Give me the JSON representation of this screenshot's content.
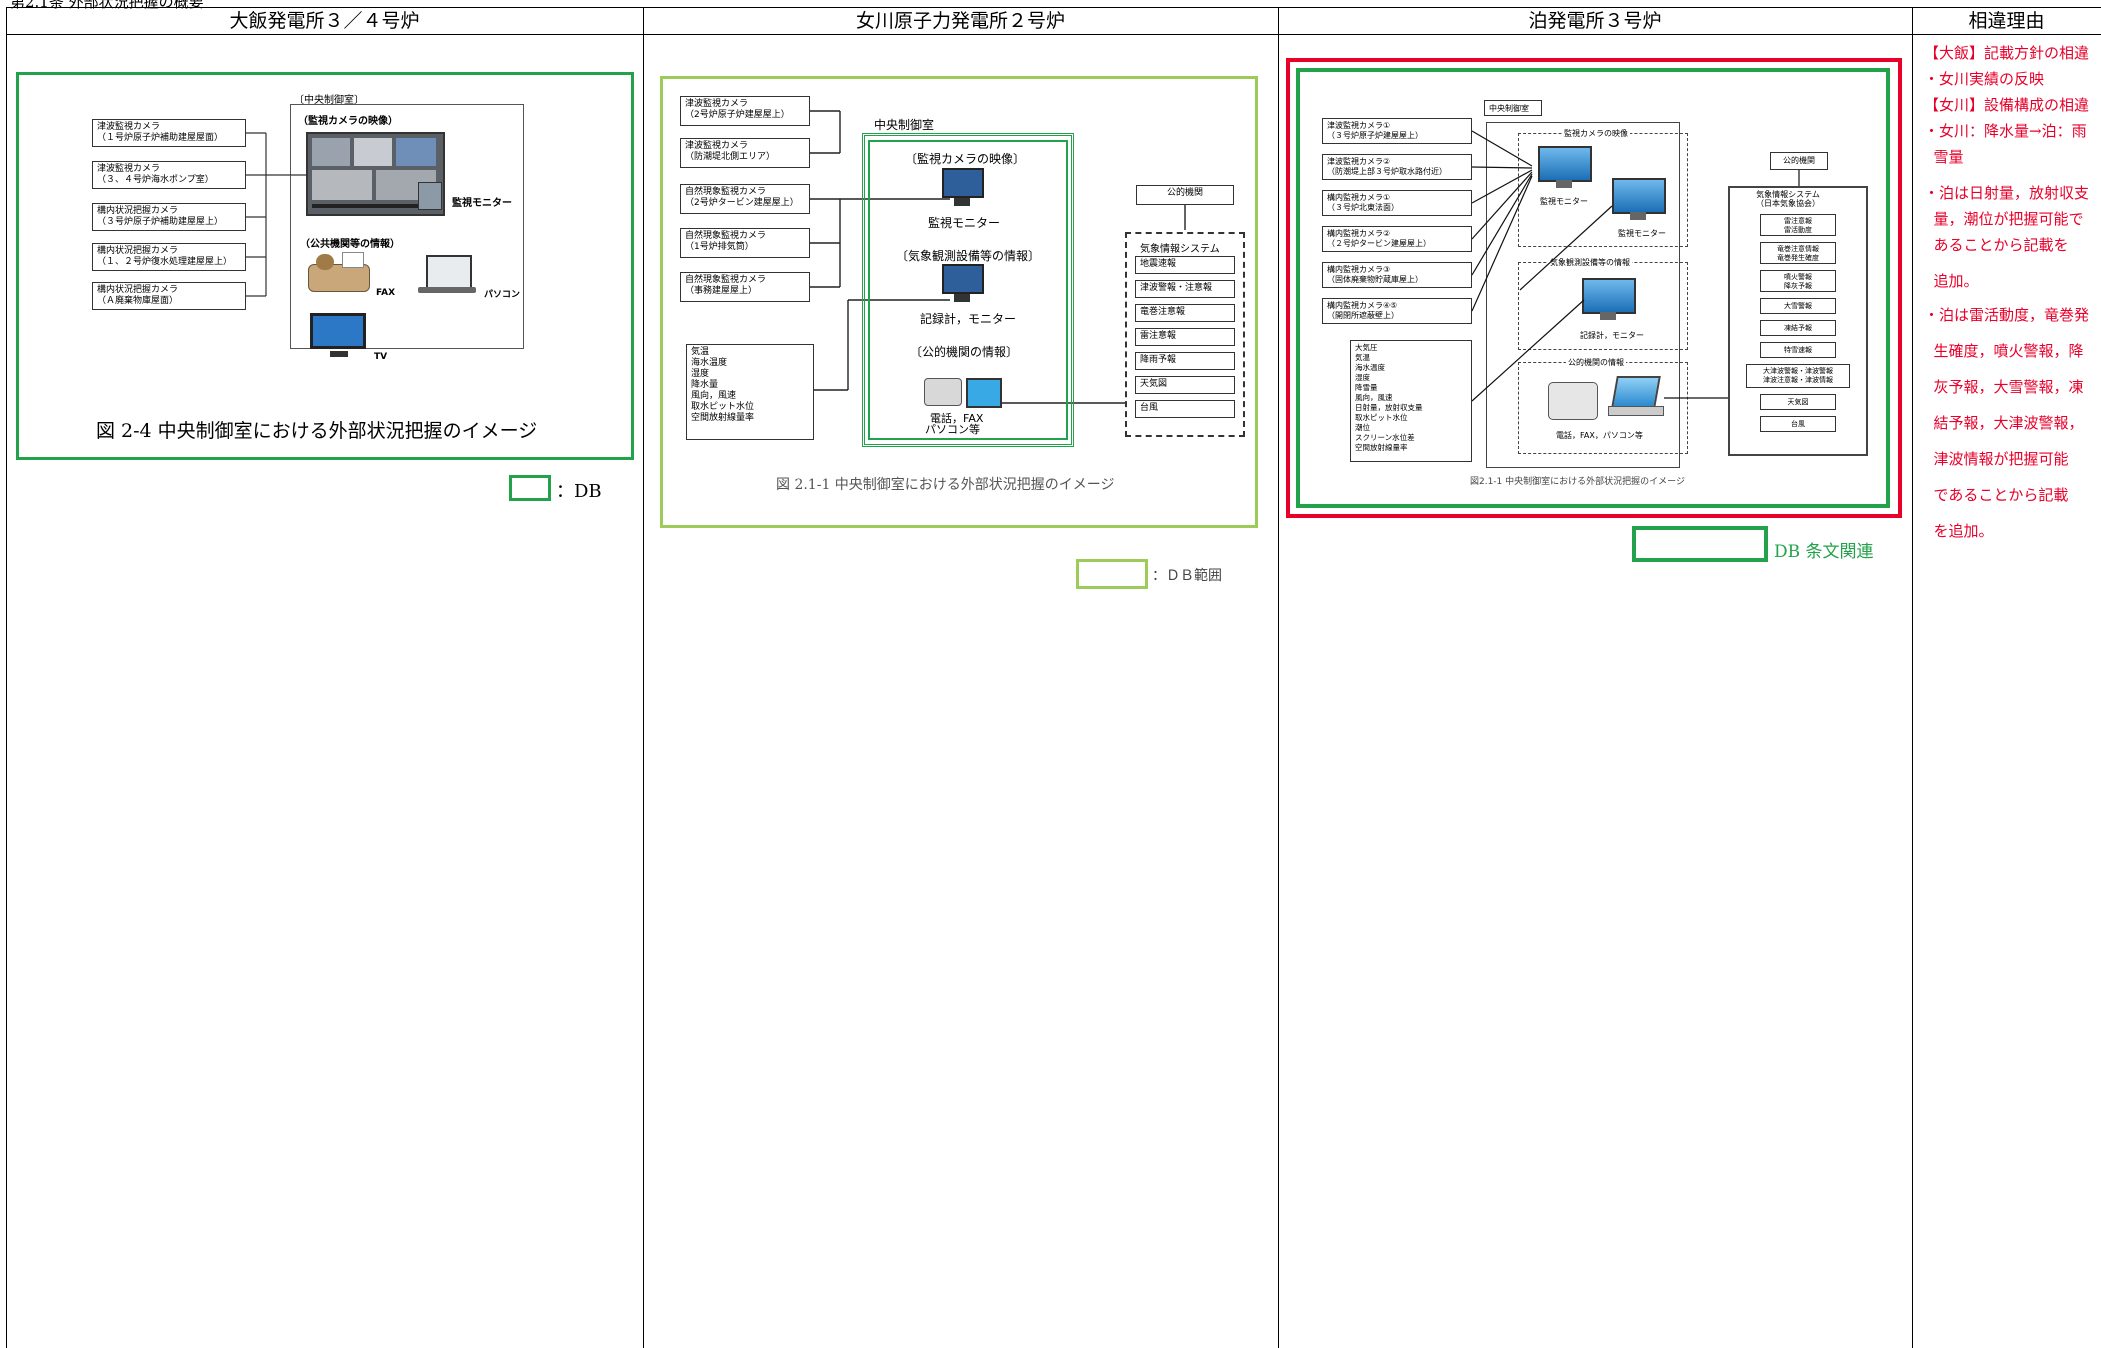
{
  "top_caption": "第2.1条  外部状況把握の概要",
  "columns": {
    "ohi": "大飯発電所３／４号炉",
    "onagawa": "女川原子力発電所２号炉",
    "tomari": "泊発電所３号炉",
    "reason": "相違理由"
  },
  "ohi": {
    "room": "〔中央制御室〕",
    "camera_section": "（監視カメラの映像）",
    "monitor": "監視モニター",
    "public_section": "（公共機関等の情報）",
    "fax": "FAX",
    "pc": "パソコン",
    "tv": "TV",
    "cameras": [
      "津波監視カメラ\n（１号炉原子炉補助建屋屋面）",
      "津波監視カメラ\n（３、４号炉海水ポンプ室）",
      "構内状況把握カメラ\n（３号炉原子炉補助建屋屋上）",
      "構内状況把握カメラ\n（１、２号炉復水処理建屋屋上）",
      "構内状況把握カメラ\n（Ａ廃棄物庫屋面）"
    ],
    "caption": "図 2-4  中央制御室における外部状況把握のイメージ",
    "legend": "：DB"
  },
  "onagawa": {
    "room": "中央制御室",
    "camera_section": "〔監視カメラの映像〕",
    "monitor": "監視モニター",
    "weather_section": "〔気象観測設備等の情報〕",
    "recorder": "記録計，モニター",
    "public_section": "〔公的機関の情報〕",
    "phone": "電話，FAX",
    "pc": "パソコン等",
    "public_org": "公的機関",
    "weather_system": "気象情報システム",
    "info_items": [
      "地震速報",
      "津波警報・注意報",
      "竜巻注意報",
      "雷注意報",
      "降雨予報",
      "天気図",
      "台風"
    ],
    "cameras": [
      "津波監視カメラ\n（2号炉原子炉建屋屋上）",
      "津波監視カメラ\n（防潮堤北側エリア）",
      "自然現象監視カメラ\n（2号炉タービン建屋屋上）",
      "自然現象監視カメラ\n（1号炉排気筒）",
      "自然現象監視カメラ\n（事務建屋屋上）"
    ],
    "weather_items": [
      "気温",
      "海水温度",
      "湿度",
      "降水量",
      "風向，風速",
      "取水ピット水位",
      "空間放射線量率"
    ],
    "caption": "図 2.1-1  中央制御室における外部状況把握のイメージ",
    "legend": "：ＤＢ範囲"
  },
  "tomari": {
    "room": "中央制御室",
    "camera_section": "監視カメラの映像",
    "monitor": "監視モニター",
    "monitor2": "監視モニター",
    "weather_section": "気象観測設備等の情報",
    "recorder": "記録計，モニター",
    "public_section": "公的機関の情報",
    "phone": "電話，FAX，パソコン等",
    "public_org": "公的機関",
    "weather_system": "気象情報システム\n（日本気象協会）",
    "info_items": [
      "雷注意報\n雷活動度",
      "竜巻注意情報\n竜巻発生確度",
      "噴火警報\n降灰予報",
      "大雪警報",
      "凍結予報",
      "特雪速報",
      "大津波警報・津波警報\n津波注意報・津波情報",
      "天気図",
      "台風"
    ],
    "cameras": [
      "津波監視カメラ①\n（３号炉原子炉建屋屋上）",
      "津波監視カメラ②\n（防潮堤上部３号炉取水路付近）",
      "構内監視カメラ①\n（３号炉北東法面）",
      "構内監視カメラ②\n（２号炉タービン建屋屋上）",
      "構内監視カメラ③\n（固体廃棄物貯蔵庫屋上）",
      "構内監視カメラ④⑤\n（開閉所遮蔽壁上）"
    ],
    "weather_items": [
      "大気圧",
      "気温",
      "海水温度",
      "湿度",
      "降雪量",
      "風向，風速",
      "日射量，放射収支量",
      "取水ピット水位",
      "潮位",
      "スクリーン水位差",
      "空間放射線量率"
    ],
    "caption": "図2.1-1  中央制御室における外部状況把握のイメージ",
    "legend": "DB 条文関連"
  },
  "reason": {
    "lines": [
      "【大飯】記載方針の相違",
      "・女川実績の反映",
      "【女川】設備構成の相違",
      "・女川：降水量→泊：雨",
      "  雪量",
      "・泊は日射量，放射収支",
      "  量，潮位が把握可能で",
      "  あることから記載を",
      "  追加。",
      "・泊は雷活動度，竜巻発",
      "  生確度，噴火警報，降",
      "  灰予報，大雪警報，凍",
      "  結予報，大津波警報，",
      "  津波情報が把握可能",
      "  であることから記載",
      "  を追加。"
    ]
  },
  "colors": {
    "green": "#22a24a",
    "lightgreen": "#9ccb5a",
    "red": "#e8002a",
    "redtext": "#e8002a"
  }
}
